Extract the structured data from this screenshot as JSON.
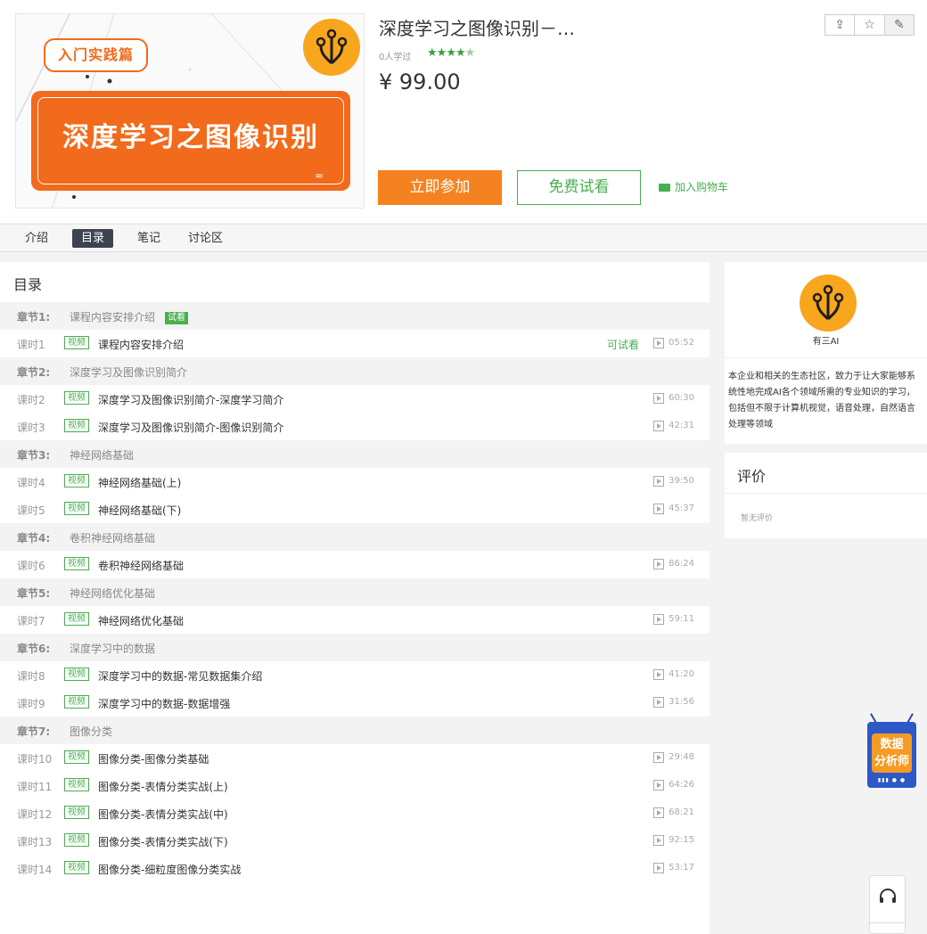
{
  "course": {
    "cover": {
      "tag": "入门实践篇",
      "title": "深度学习之图像识别"
    },
    "title": "深度学习之图像识别－…",
    "learners": "0人学过",
    "rating_stars": 4.5,
    "price": "¥ 99.00",
    "actions": {
      "join": "立即参加",
      "trial": "免费试看",
      "cart": "加入购物车"
    },
    "header_icons": [
      "share-icon",
      "star-icon",
      "edit-icon"
    ]
  },
  "tabs": [
    {
      "label": "介绍",
      "active": false
    },
    {
      "label": "目录",
      "active": true
    },
    {
      "label": "笔记",
      "active": false
    },
    {
      "label": "讨论区",
      "active": false
    }
  ],
  "catalog": {
    "title": "目录",
    "rows": [
      {
        "type": "chapter",
        "label": "章节1:",
        "title": "课程内容安排介绍",
        "badge": "试看"
      },
      {
        "type": "lesson",
        "label": "课时1",
        "tag": "视频",
        "title": "课程内容安排介绍",
        "trial": "可试看",
        "duration": "05:52"
      },
      {
        "type": "chapter",
        "label": "章节2:",
        "title": "深度学习及图像识别简介"
      },
      {
        "type": "lesson",
        "label": "课时2",
        "tag": "视频",
        "title": "深度学习及图像识别简介-深度学习简介",
        "duration": "60:30"
      },
      {
        "type": "lesson",
        "label": "课时3",
        "tag": "视频",
        "title": "深度学习及图像识别简介-图像识别简介",
        "duration": "42:31"
      },
      {
        "type": "chapter",
        "label": "章节3:",
        "title": "神经网络基础"
      },
      {
        "type": "lesson",
        "label": "课时4",
        "tag": "视频",
        "title": "神经网络基础(上)",
        "duration": "39:50"
      },
      {
        "type": "lesson",
        "label": "课时5",
        "tag": "视频",
        "title": "神经网络基础(下)",
        "duration": "45:37"
      },
      {
        "type": "chapter",
        "label": "章节4:",
        "title": "卷积神经网络基础"
      },
      {
        "type": "lesson",
        "label": "课时6",
        "tag": "视频",
        "title": "卷积神经网络基础",
        "duration": "86:24"
      },
      {
        "type": "chapter",
        "label": "章节5:",
        "title": "神经网络优化基础"
      },
      {
        "type": "lesson",
        "label": "课时7",
        "tag": "视频",
        "title": "神经网络优化基础",
        "duration": "59:11"
      },
      {
        "type": "chapter",
        "label": "章节6:",
        "title": "深度学习中的数据"
      },
      {
        "type": "lesson",
        "label": "课时8",
        "tag": "视频",
        "title": "深度学习中的数据-常见数据集介绍",
        "duration": "41:20"
      },
      {
        "type": "lesson",
        "label": "课时9",
        "tag": "视频",
        "title": "深度学习中的数据-数据增强",
        "duration": "31:56"
      },
      {
        "type": "chapter",
        "label": "章节7:",
        "title": "图像分类"
      },
      {
        "type": "lesson",
        "label": "课时10",
        "tag": "视频",
        "title": "图像分类-图像分类基础",
        "duration": "29:48"
      },
      {
        "type": "lesson",
        "label": "课时11",
        "tag": "视频",
        "title": "图像分类-表情分类实战(上)",
        "duration": "64:26"
      },
      {
        "type": "lesson",
        "label": "课时12",
        "tag": "视频",
        "title": "图像分类-表情分类实战(中)",
        "duration": "68:21"
      },
      {
        "type": "lesson",
        "label": "课时13",
        "tag": "视频",
        "title": "图像分类-表情分类实战(下)",
        "duration": "92:15"
      },
      {
        "type": "lesson",
        "label": "课时14",
        "tag": "视频",
        "title": "图像分类-细粒度图像分类实战",
        "duration": "53:17"
      }
    ]
  },
  "provider": {
    "name": "有三AI",
    "description": "本企业和相关的生态社区，致力于让大家能够系统性地完成AI各个领域所需的专业知识的学习，包括但不限于计算机视觉，语音处理，自然语言处理等领域"
  },
  "reviews": {
    "title": "评价",
    "empty": "暂无评价"
  },
  "float_ad": {
    "text_line1": "数据",
    "text_line2": "分析师"
  },
  "colors": {
    "accent_orange": "#f58220",
    "accent_green": "#49af4f",
    "tab_active_bg": "#3d4350",
    "logo_yellow": "#f7a61e"
  }
}
